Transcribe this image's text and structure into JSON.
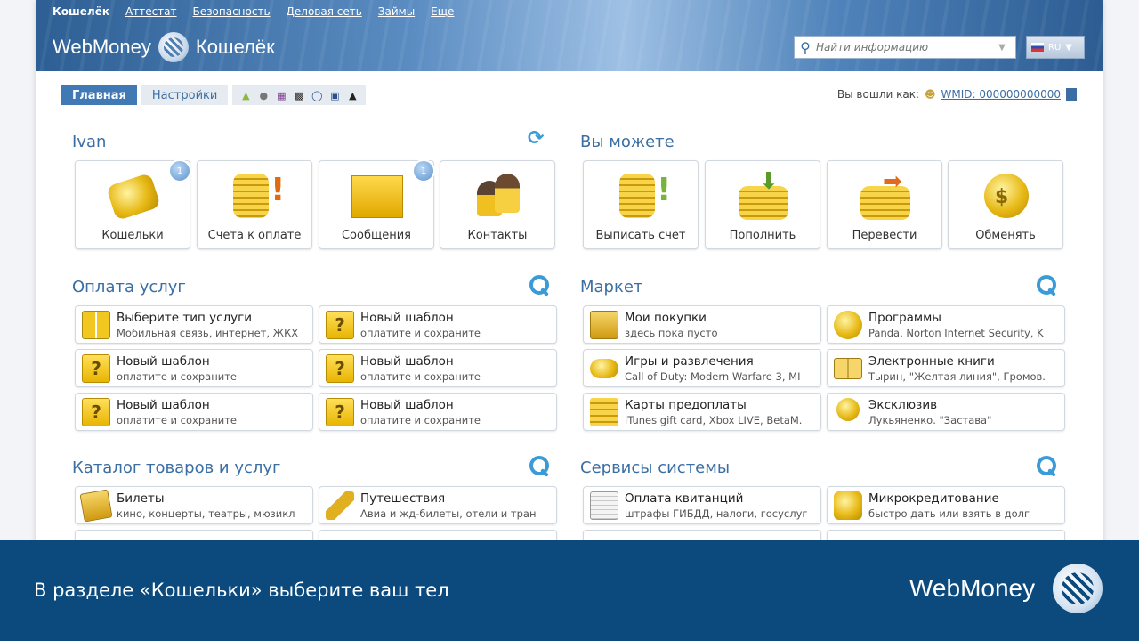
{
  "topnav": [
    "Кошелёк",
    "Аттестат",
    "Безопасность",
    "Деловая сеть",
    "Займы",
    "Еще"
  ],
  "logo": {
    "brand": "WebMoney",
    "product": "Кошелёк"
  },
  "search": {
    "placeholder": "Найти информацию"
  },
  "lang": {
    "code": "RU"
  },
  "tabs": {
    "main": "Главная",
    "settings": "Настройки"
  },
  "platform_icons": [
    "android-icon",
    "apple-icon",
    "windows-icon",
    "blackberry-icon",
    "opera-icon",
    "windows-mobile-icon",
    "linux-icon"
  ],
  "login": {
    "label": "Вы вошли как:",
    "wmid": "WMID: 000000000000"
  },
  "user": {
    "title": "Ivan",
    "tiles": [
      {
        "label": "Кошельки",
        "badge": "1",
        "icon": "wallet-icon"
      },
      {
        "label": "Счета к оплате",
        "badge": "",
        "icon": "coins-exclamation-icon"
      },
      {
        "label": "Сообщения",
        "badge": "1",
        "icon": "envelopes-icon"
      },
      {
        "label": "Контакты",
        "badge": "",
        "icon": "contacts-icon"
      }
    ]
  },
  "can": {
    "title": "Вы можете",
    "tiles": [
      {
        "label": "Выписать счет",
        "icon": "invoice-icon"
      },
      {
        "label": "Пополнить",
        "icon": "topup-icon"
      },
      {
        "label": "Перевести",
        "icon": "transfer-icon"
      },
      {
        "label": "Обменять",
        "icon": "exchange-icon"
      }
    ]
  },
  "services": {
    "title": "Оплата услуг",
    "items": [
      {
        "title": "Выберите тип услуги",
        "sub": "Мобильная связь, интернет, ЖКХ"
      },
      {
        "title": "Новый шаблон",
        "sub": "оплатите и сохраните"
      },
      {
        "title": "Новый шаблон",
        "sub": "оплатите и сохраните"
      },
      {
        "title": "Новый шаблон",
        "sub": "оплатите и сохраните"
      },
      {
        "title": "Новый шаблон",
        "sub": "оплатите и сохраните"
      },
      {
        "title": "Новый шаблон",
        "sub": "оплатите и сохраните"
      }
    ]
  },
  "market": {
    "title": "Маркет",
    "items": [
      {
        "title": "Мои покупки",
        "sub": "здесь пока пусто"
      },
      {
        "title": "Программы",
        "sub": "Panda, Norton Internet Security, K"
      },
      {
        "title": "Игры и развлечения",
        "sub": "Call of Duty: Modern Warfare 3, MI"
      },
      {
        "title": "Электронные книги",
        "sub": "Тырин, \"Желтая линия\", Громов."
      },
      {
        "title": "Карты предоплаты",
        "sub": "iTunes gift card, Xbox LIVE, BetaM."
      },
      {
        "title": "Эксклюзив",
        "sub": "Лукьяненко. \"Застава\""
      }
    ]
  },
  "catalog": {
    "title": "Каталог товаров и услуг",
    "items": [
      {
        "title": "Билеты",
        "sub": "кино, концерты, театры, мюзикл"
      },
      {
        "title": "Путешествия",
        "sub": "Авиа и жд-билеты, отели и тран"
      }
    ]
  },
  "system": {
    "title": "Сервисы системы",
    "items": [
      {
        "title": "Оплата квитанций",
        "sub": "штрафы ГИБДД, налоги, госуслуг"
      },
      {
        "title": "Микрокредитование",
        "sub": "быстро дать или взять в долг"
      }
    ]
  },
  "caption": {
    "text": "В разделе «Кошельки» выберите ваш тел",
    "brand": "WebMoney"
  }
}
